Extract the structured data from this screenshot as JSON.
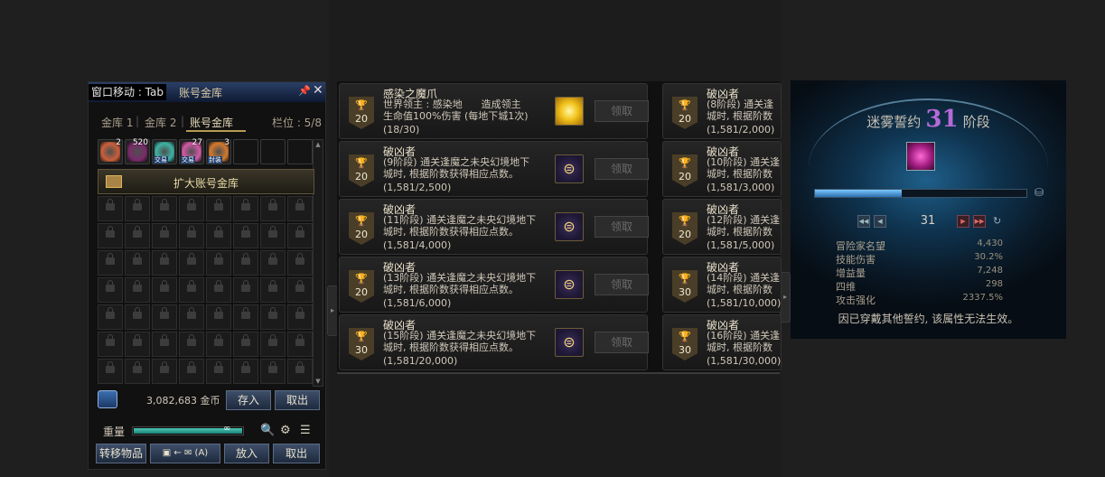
{
  "vault": {
    "title_move": "窗口移动 : Tab",
    "title": "账号金库",
    "tabs": [
      "金库 1",
      "金库 2",
      "账号金库"
    ],
    "slot_label": "栏位 : 5/8",
    "items": [
      {
        "count": "2",
        "tag": "",
        "color": "#c9603a"
      },
      {
        "count": "520",
        "tag": "",
        "color": "#7a2a6a"
      },
      {
        "count": "",
        "tag": "交易",
        "color": "#3fb3a4"
      },
      {
        "count": "27",
        "tag": "交易",
        "color": "#d15aa6"
      },
      {
        "count": "3",
        "tag": "封装",
        "color": "#d47a2e"
      }
    ],
    "expand_label": "扩大账号金库",
    "gold_amount": "3,082,683 金币",
    "deposit_label": "存入",
    "withdraw_label": "取出",
    "weight_label": "重量",
    "weight_symbol": "∞",
    "transfer_label": "转移物品",
    "auto_label": "(A)",
    "put_label": "放入",
    "take_label": "取出"
  },
  "achievements": {
    "claim_label": "领取",
    "left": [
      {
        "badge": "20",
        "title": "感染之魔爪",
        "desc": "世界领主 : 感染地      造成领主\n生命值100%伤害 (每地下城1次)",
        "progress": "(18/30)",
        "reward": "star"
      },
      {
        "badge": "20",
        "title": "破凶者",
        "desc": "(9阶段) 通关逢魔之未央幻境地下\n城时, 根据阶数获得相应点数。",
        "progress": "(1,581/2,500)",
        "reward": "emblem"
      },
      {
        "badge": "20",
        "title": "破凶者",
        "desc": "(11阶段) 通关逢魔之未央幻境地下\n城时, 根据阶数获得相应点数。",
        "progress": "(1,581/4,000)",
        "reward": "emblem"
      },
      {
        "badge": "20",
        "title": "破凶者",
        "desc": "(13阶段) 通关逢魔之未央幻境地下\n城时, 根据阶数获得相应点数。",
        "progress": "(1,581/6,000)",
        "reward": "emblem"
      },
      {
        "badge": "30",
        "title": "破凶者",
        "desc": "(15阶段) 通关逢魔之未央幻境地下\n城时, 根据阶数获得相应点数。",
        "progress": "(1,581/20,000)",
        "reward": "emblem"
      }
    ],
    "right": [
      {
        "badge": "20",
        "title": "破凶者",
        "desc": "(8阶段) 通关逢\n城时, 根据阶数",
        "progress": "(1,581/2,000)"
      },
      {
        "badge": "20",
        "title": "破凶者",
        "desc": "(10阶段) 通关逢\n城时, 根据阶数",
        "progress": "(1,581/3,000)"
      },
      {
        "badge": "20",
        "title": "破凶者",
        "desc": "(12阶段) 通关逢\n城时, 根据阶数",
        "progress": "(1,581/5,000)"
      },
      {
        "badge": "30",
        "title": "破凶者",
        "desc": "(14阶段) 通关逢\n城时, 根据阶数",
        "progress": "(1,581/10,000)"
      },
      {
        "badge": "30",
        "title": "破凶者",
        "desc": "(16阶段) 通关逢\n城时, 根据阶数",
        "progress": "(1,581/30,000)"
      }
    ]
  },
  "stage": {
    "title_prefix": "迷雾誓约",
    "stage_number": "31",
    "title_suffix": "阶段",
    "progress_fraction": 0.41,
    "pager_value": "31",
    "stats": [
      {
        "label": "冒险家名望",
        "value": "4,430"
      },
      {
        "label": "技能伤害",
        "value": "30.2%"
      },
      {
        "label": "增益量",
        "value": "7,248"
      },
      {
        "label": "四维",
        "value": "298"
      },
      {
        "label": "攻击强化",
        "value": "2337.5%"
      }
    ],
    "footer": "因已穿戴其他誓约,  该属性无法生效。"
  },
  "icons": {
    "trophy": "trophy-icon",
    "lock": "lock-icon",
    "search": "search-icon",
    "gear": "gear-icon",
    "list": "list-icon",
    "refresh": "refresh-icon"
  }
}
